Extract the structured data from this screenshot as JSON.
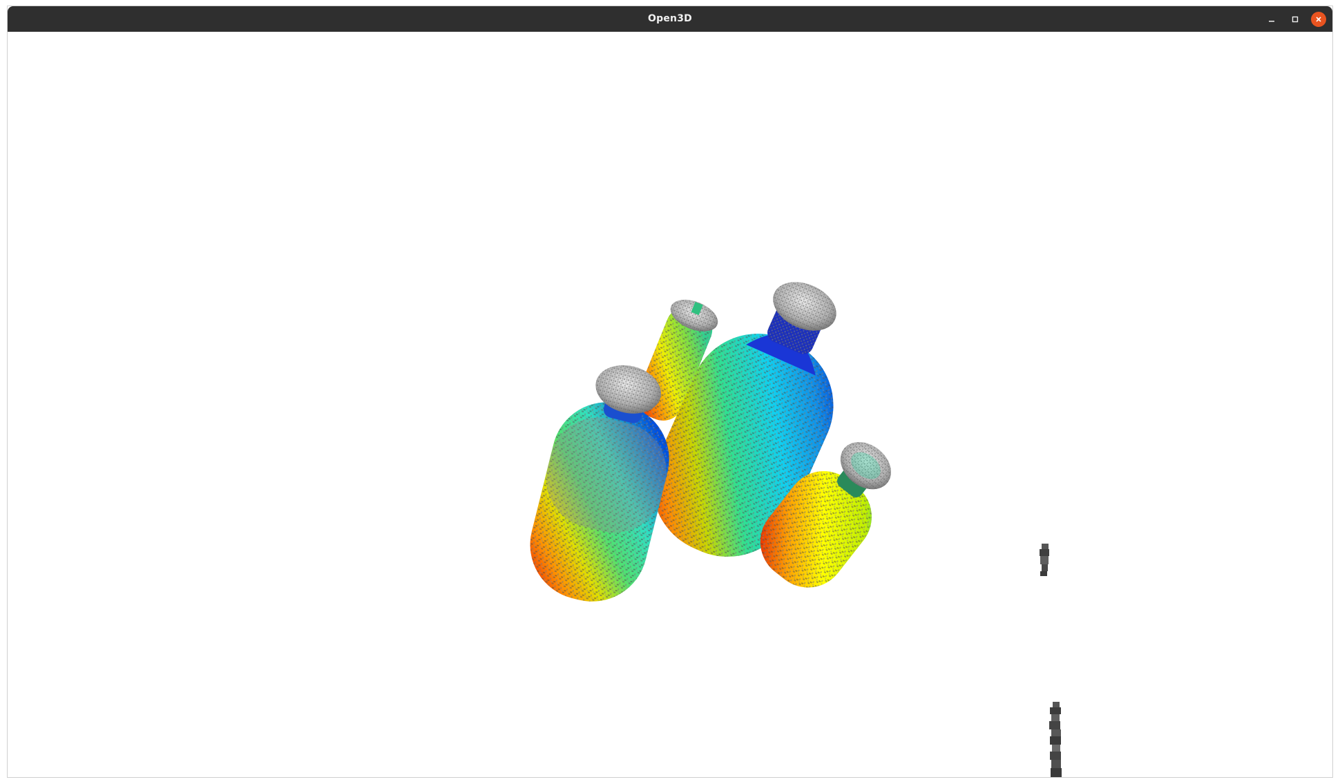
{
  "window": {
    "title": "Open3D"
  },
  "controls": {
    "minimize_icon": "minimize-icon",
    "maximize_icon": "maximize-icon",
    "close_icon": "close-icon",
    "close_color": "#e95420"
  },
  "scene": {
    "background": "#ffffff",
    "objects": [
      "bottle-large-center",
      "bottle-left",
      "bottle-small-back",
      "bottle-small-right",
      "stray-points-small",
      "stray-points-column"
    ],
    "colormap": [
      "#ff0000",
      "#ffff00",
      "#00ff80",
      "#00d0ff",
      "#0030ff"
    ]
  }
}
